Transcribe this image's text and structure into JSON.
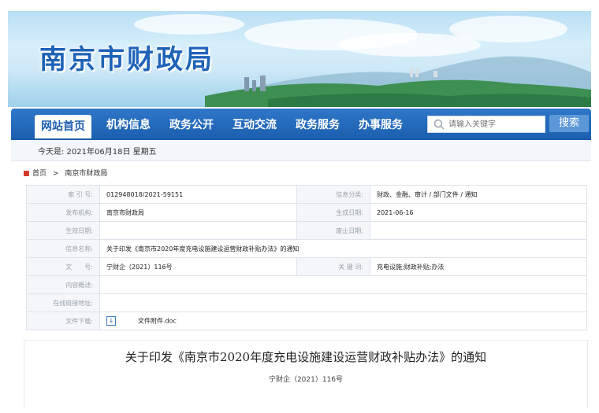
{
  "site": {
    "title": "南京市财政局"
  },
  "nav": {
    "items": [
      "网站首页",
      "机构信息",
      "政务公开",
      "互动交流",
      "政务服务",
      "办事服务"
    ],
    "search_placeholder": "请输入关键字",
    "search_button": "搜索"
  },
  "date_line": "今天是: 2021年06月18日 星期五",
  "breadcrumb": {
    "home": "首页",
    "sep": ">",
    "current": "南京市财政局"
  },
  "info": {
    "index_label": "索 引 号:",
    "index_value": "012948018/2021-59151",
    "category_label": "信息分类:",
    "category_value": "财政、金融、审计 / 部门文件 / 通知",
    "issuer_label": "发布机构:",
    "issuer_value": "南京市财政局",
    "gen_date_label": "生成日期:",
    "gen_date_value": "2021-06-16",
    "eff_date_label": "生效日期:",
    "eff_date_value": "",
    "abolish_label": "废止日期:",
    "abolish_value": "",
    "name_label": "信息名称:",
    "name_value": "关于印发《南京市2020年度充电设施建设运营财政补贴办法》的通知",
    "docno_label": "文　　号:",
    "docno_value": "宁财企（2021）116号",
    "keywords_label": "关 键 词:",
    "keywords_value": "充电设施;财政补贴;办法",
    "overview_label": "内容概述:",
    "overview_value": "",
    "link_label": "在线链接地址:",
    "link_value": "",
    "download_label": "文件下载:",
    "download_value": "文件附件.doc"
  },
  "article": {
    "title": "关于印发《南京市2020年度充电设施建设运营财政补贴办法》的通知",
    "doc_number": "宁财企（2021）116号"
  }
}
